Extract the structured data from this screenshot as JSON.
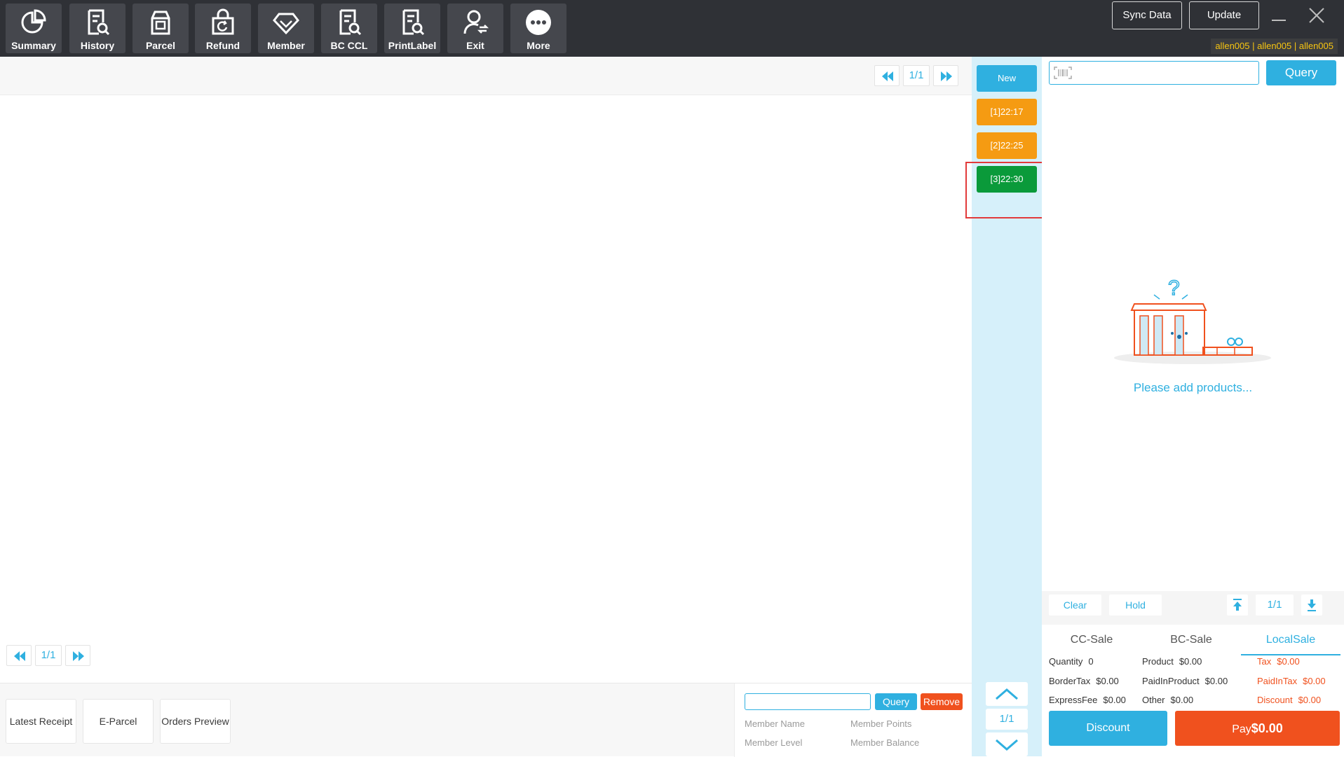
{
  "toolbar": {
    "items": [
      {
        "label": "Summary",
        "icon": "pie-chart-icon"
      },
      {
        "label": "History",
        "icon": "document-search-icon"
      },
      {
        "label": "Parcel",
        "icon": "parcel-box-icon"
      },
      {
        "label": "Refund",
        "icon": "refund-bag-icon"
      },
      {
        "label": "Member",
        "icon": "diamond-icon"
      },
      {
        "label": "BC CCL",
        "icon": "document-search-icon"
      },
      {
        "label": "PrintLabel",
        "icon": "document-search-icon"
      },
      {
        "label": "Exit",
        "icon": "user-switch-icon"
      },
      {
        "label": "More",
        "icon": "more-dots-icon"
      }
    ],
    "sync_label": "Sync Data",
    "update_label": "Update",
    "user_tag": "allen005 | allen005 | allen005"
  },
  "main": {
    "top_pager": "1/1",
    "bottom_pager": "1/1",
    "footer_buttons": [
      "Latest Receipt",
      "E-Parcel",
      "Orders Preview"
    ],
    "member": {
      "query_label": "Query",
      "remove_label": "Remove",
      "name_label": "Member Name",
      "points_label": "Member Points",
      "level_label": "Member Level",
      "balance_label": "Member Balance"
    }
  },
  "orders": {
    "new_label": "New",
    "tabs": [
      {
        "label": "[1]22:17",
        "state": "held"
      },
      {
        "label": "[2]22:25",
        "state": "held"
      },
      {
        "label": "[3]22:30",
        "state": "active"
      }
    ],
    "pager": "1/1"
  },
  "cart": {
    "query_label": "Query",
    "empty_text": "Please add products...",
    "clear_label": "Clear",
    "hold_label": "Hold",
    "pager": "1/1",
    "sale_tabs": [
      "CC-Sale",
      "BC-Sale",
      "LocalSale"
    ],
    "active_sale_tab": "LocalSale",
    "summary": {
      "quantity": {
        "label": "Quantity",
        "value": "0"
      },
      "product": {
        "label": "Product",
        "value": "$0.00"
      },
      "tax": {
        "label": "Tax",
        "value": "$0.00"
      },
      "border_tax": {
        "label": "BorderTax",
        "value": "$0.00"
      },
      "paid_in_product": {
        "label": "PaidInProduct",
        "value": "$0.00"
      },
      "paid_in_tax": {
        "label": "PaidInTax",
        "value": "$0.00"
      },
      "express_fee": {
        "label": "ExpressFee",
        "value": "$0.00"
      },
      "other": {
        "label": "Other",
        "value": "$0.00"
      },
      "discount": {
        "label": "Discount",
        "value": "$0.00"
      }
    },
    "discount_label": "Discount",
    "pay_label": "Pay",
    "pay_amount": "$0.00"
  },
  "colors": {
    "accent": "#2fb0e0",
    "held_order": "#f59b12",
    "active_order": "#0a9a3a",
    "danger": "#f0511e",
    "toolbar_bg": "#2f3136"
  }
}
